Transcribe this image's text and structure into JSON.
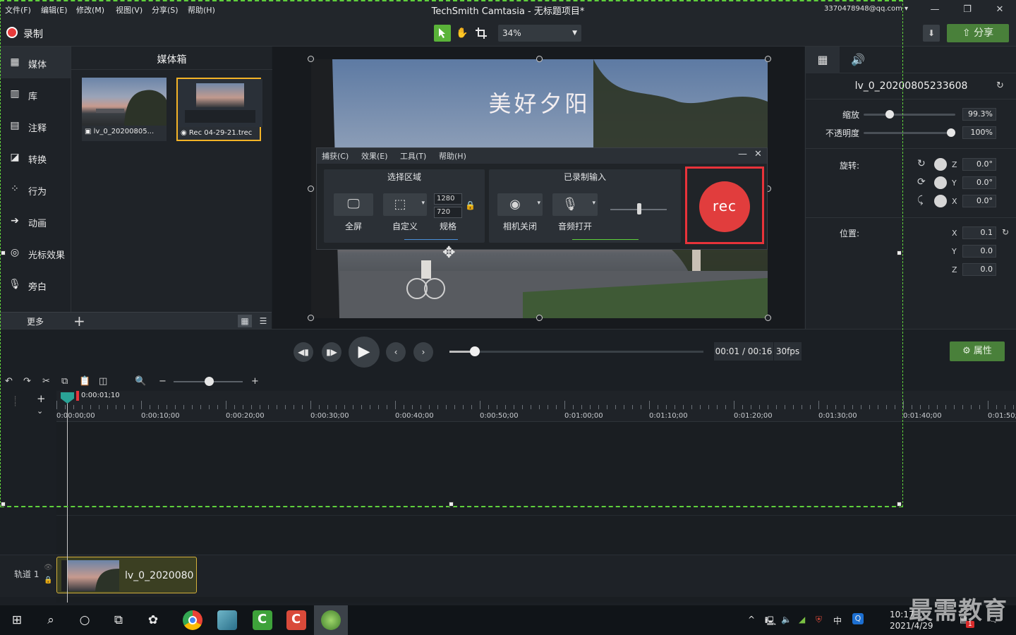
{
  "window": {
    "title": "TechSmith Camtasia - 无标题项目*",
    "account": "3370478948@qq.com",
    "menu": [
      "文件(F)",
      "编辑(E)",
      "修改(M)",
      "视图(V)",
      "分享(S)",
      "帮助(H)"
    ]
  },
  "toolbar": {
    "record_label": "录制",
    "zoom_value": "34%",
    "share_label": "分享"
  },
  "sidebar": {
    "items": [
      {
        "label": "媒体",
        "icon": "film-icon"
      },
      {
        "label": "库",
        "icon": "library-icon"
      },
      {
        "label": "注释",
        "icon": "annotation-icon"
      },
      {
        "label": "转换",
        "icon": "transition-icon"
      },
      {
        "label": "行为",
        "icon": "behavior-icon"
      },
      {
        "label": "动画",
        "icon": "animation-icon"
      },
      {
        "label": "光标效果",
        "icon": "cursor-effect-icon"
      },
      {
        "label": "旁白",
        "icon": "microphone-icon"
      }
    ],
    "more_label": "更多"
  },
  "media_bin": {
    "title": "媒体箱",
    "items": [
      {
        "name": "lv_0_20200805...",
        "kind": "video"
      },
      {
        "name": "Rec 04-29-21.trec",
        "kind": "recording"
      }
    ]
  },
  "canvas": {
    "video_text": "美好夕阳"
  },
  "recorder": {
    "menu": [
      "捕获(C)",
      "效果(E)",
      "工具(T)",
      "帮助(H)"
    ],
    "area_title": "选择区域",
    "area_buttons": [
      "全屏",
      "自定义",
      "规格"
    ],
    "width": "1280",
    "height": "720",
    "input_title": "已录制输入",
    "input_buttons": [
      "相机关闭",
      "音频打开"
    ],
    "rec_label": "rec"
  },
  "properties": {
    "clip_name": "lv_0_20200805233608",
    "scale_label": "缩放",
    "scale_value": "99.3%",
    "scale_fraction": 0.26,
    "opacity_label": "不透明度",
    "opacity_value": "100%",
    "opacity_fraction": 1.0,
    "rotation_label": "旋转:",
    "rotation": [
      {
        "axis": "Z",
        "value": "0.0°"
      },
      {
        "axis": "Y",
        "value": "0.0°"
      },
      {
        "axis": "X",
        "value": "0.0°"
      }
    ],
    "position_label": "位置:",
    "position": [
      {
        "axis": "X",
        "value": "0.1"
      },
      {
        "axis": "Y",
        "value": "0.0"
      },
      {
        "axis": "Z",
        "value": "0.0"
      }
    ],
    "properties_button": "属性"
  },
  "playback": {
    "time": "00:01 / 00:16",
    "fps": "30fps",
    "progress_fraction": 0.1
  },
  "timeline": {
    "playhead_time": "0:00:01;10",
    "ticks": [
      "0:00:00;00",
      "0:00:10;00",
      "0:00:20;00",
      "0:00:30;00",
      "0:00:40;00",
      "0:00:50;00",
      "0:01:00;00",
      "0:01:10;00",
      "0:01:20;00",
      "0:01:30;00",
      "0:01:40;00",
      "0:01:50;00"
    ],
    "track_label": "轨道 1",
    "clip_name": "lv_0_2020080"
  },
  "taskbar": {
    "time": "10:17",
    "date": "2021/4/29",
    "ime": "中",
    "notification_count": "1"
  },
  "watermark": "最需教育"
}
